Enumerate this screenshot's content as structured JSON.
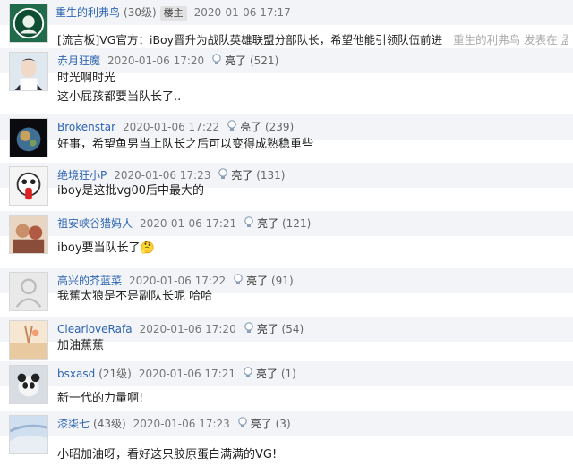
{
  "original_post": {
    "author": "重生的利弗鸟",
    "level": "(30级)",
    "badge": "楼主",
    "time": "2020-01-06 17:17",
    "title": "[流言板]VG官方：iBoy晋升为战队英雄联盟分部队长，希望他能引领队伍前进",
    "trailing": "重生的利弗鸟 发表在 孟"
  },
  "comments": [
    {
      "author": "赤月狂魔",
      "level": "",
      "time": "2020-01-06 17:20",
      "like": "亮了",
      "count": "(521)",
      "lines": [
        "时光啊时光",
        "这小屁孩都要当队长了.."
      ]
    },
    {
      "author": "Brokenstar",
      "level": "",
      "time": "2020-01-06 17:22",
      "like": "亮了",
      "count": "(239)",
      "lines": [
        "好事，希望鱼男当上队长之后可以变得成熟稳重些"
      ]
    },
    {
      "author": "绝境狂小P",
      "level": "",
      "time": "2020-01-06 17:23",
      "like": "亮了",
      "count": "(131)",
      "lines": [
        "iboy是这批vg00后中最大的"
      ]
    },
    {
      "author": "祖安峡谷猎妈人",
      "level": "",
      "time": "2020-01-06 17:21",
      "like": "亮了",
      "count": "(121)",
      "lines": [
        "iboy要当队长了🤔"
      ]
    },
    {
      "author": "高兴的芥蓝菜",
      "level": "",
      "time": "2020-01-06 17:22",
      "like": "亮了",
      "count": "(91)",
      "lines": [
        "我蕉太狼是不是副队长呢 哈哈"
      ]
    },
    {
      "author": "ClearloveRafa",
      "level": "",
      "time": "2020-01-06 17:20",
      "like": "亮了",
      "count": "(54)",
      "lines": [
        "加油蕉蕉"
      ]
    },
    {
      "author": "bsxasd",
      "level": "(21级)",
      "time": "2020-01-06 17:21",
      "like": "亮了",
      "count": "(1)",
      "lines": [
        "新一代的力量啊!"
      ]
    },
    {
      "author": "漆柒七",
      "level": "(43级)",
      "time": "2020-01-06 17:23",
      "like": "亮了",
      "count": "(3)",
      "lines": [
        "小昭加油呀，看好这只胶原蛋白满满的VG!"
      ]
    }
  ],
  "colors": {
    "name": "#2d64b3",
    "row_bg": "#f2f4f7",
    "text": "#222222"
  },
  "icons": {
    "like": "lightbulb-icon"
  }
}
